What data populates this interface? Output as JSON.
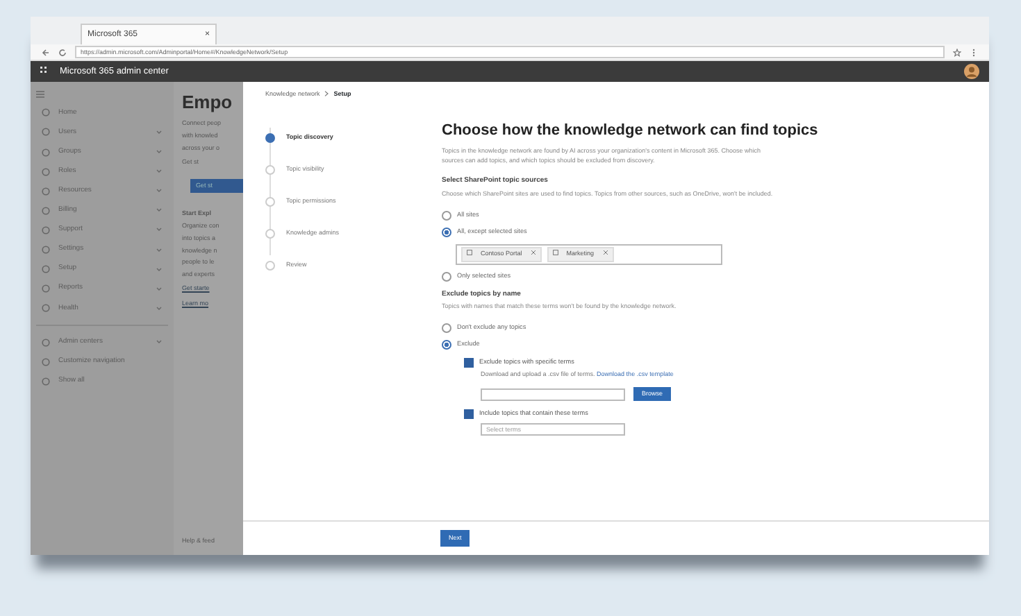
{
  "browser": {
    "tab_title": "Microsoft 365",
    "tab_close": "×",
    "address": "https://admin.microsoft.com/Adminportal/Home#/KnowledgeNetwork/Setup"
  },
  "header": {
    "app_title": "Microsoft 365 admin center"
  },
  "nav": {
    "items": [
      {
        "label": "Home",
        "expandable": false
      },
      {
        "label": "Users",
        "expandable": true
      },
      {
        "label": "Groups",
        "expandable": true
      },
      {
        "label": "Roles",
        "expandable": true
      },
      {
        "label": "Resources",
        "expandable": true
      },
      {
        "label": "Billing",
        "expandable": true
      },
      {
        "label": "Support",
        "expandable": true
      },
      {
        "label": "Settings",
        "expandable": true
      },
      {
        "label": "Setup",
        "expandable": true
      },
      {
        "label": "Reports",
        "expandable": true
      },
      {
        "label": "Health",
        "expandable": true
      }
    ],
    "footer_items": [
      {
        "label": "Admin centers",
        "expandable": true
      },
      {
        "label": "Customize navigation",
        "expandable": false
      },
      {
        "label": "Show all",
        "expandable": false
      }
    ]
  },
  "background_page": {
    "title": "Empo",
    "lines": [
      "Connect peop",
      "with knowled",
      "across your o"
    ],
    "option": "Get st",
    "button": "Get st",
    "subheading": "Start Expl",
    "body_lines": [
      "Organize con",
      "into topics a",
      "knowledge n",
      "people to le",
      "and experts"
    ],
    "links": [
      "Get starte",
      "Learn mo"
    ],
    "footer": "Help & feed"
  },
  "panel": {
    "breadcrumb": [
      {
        "label": "Knowledge network",
        "current": false
      },
      {
        "label": "Setup",
        "current": true
      }
    ],
    "steps": [
      {
        "label": "Topic discovery",
        "selected": true
      },
      {
        "label": "Topic visibility",
        "selected": false
      },
      {
        "label": "Topic permissions",
        "selected": false
      },
      {
        "label": "Knowledge admins",
        "selected": false
      },
      {
        "label": "Review",
        "selected": false
      }
    ],
    "title": "Choose how the knowledge network can find topics",
    "description": "Topics in the knowledge network are found by AI across your organization's content in Microsoft 365. Choose which sources can add topics, and which topics should be excluded from discovery.",
    "sources": {
      "heading": "Select SharePoint topic sources",
      "description": "Choose which SharePoint sites are used to find topics. Topics from other sources, such as OneDrive, won't be included.",
      "options": [
        {
          "label": "All sites",
          "selected": false
        },
        {
          "label": "All, except selected sites",
          "selected": true,
          "chips": [
            "Contoso Portal",
            "Marketing"
          ]
        },
        {
          "label": "Only selected sites",
          "selected": false
        }
      ]
    },
    "exclude": {
      "heading": "Exclude topics by name",
      "description": "Topics with names that match these terms won't be found by the knowledge network.",
      "options": [
        {
          "label": "Don't exclude any topics",
          "selected": false
        },
        {
          "label": "Exclude",
          "selected": true
        }
      ],
      "rules": [
        {
          "label": "Exclude topics with specific terms",
          "checked": true,
          "note": "Download and upload a .csv file of terms.",
          "link": "Download the .csv template",
          "button": "Browse"
        },
        {
          "label": "Include topics that contain these terms",
          "checked": true,
          "placeholder": "Select terms"
        }
      ]
    },
    "next_button": "Next"
  }
}
